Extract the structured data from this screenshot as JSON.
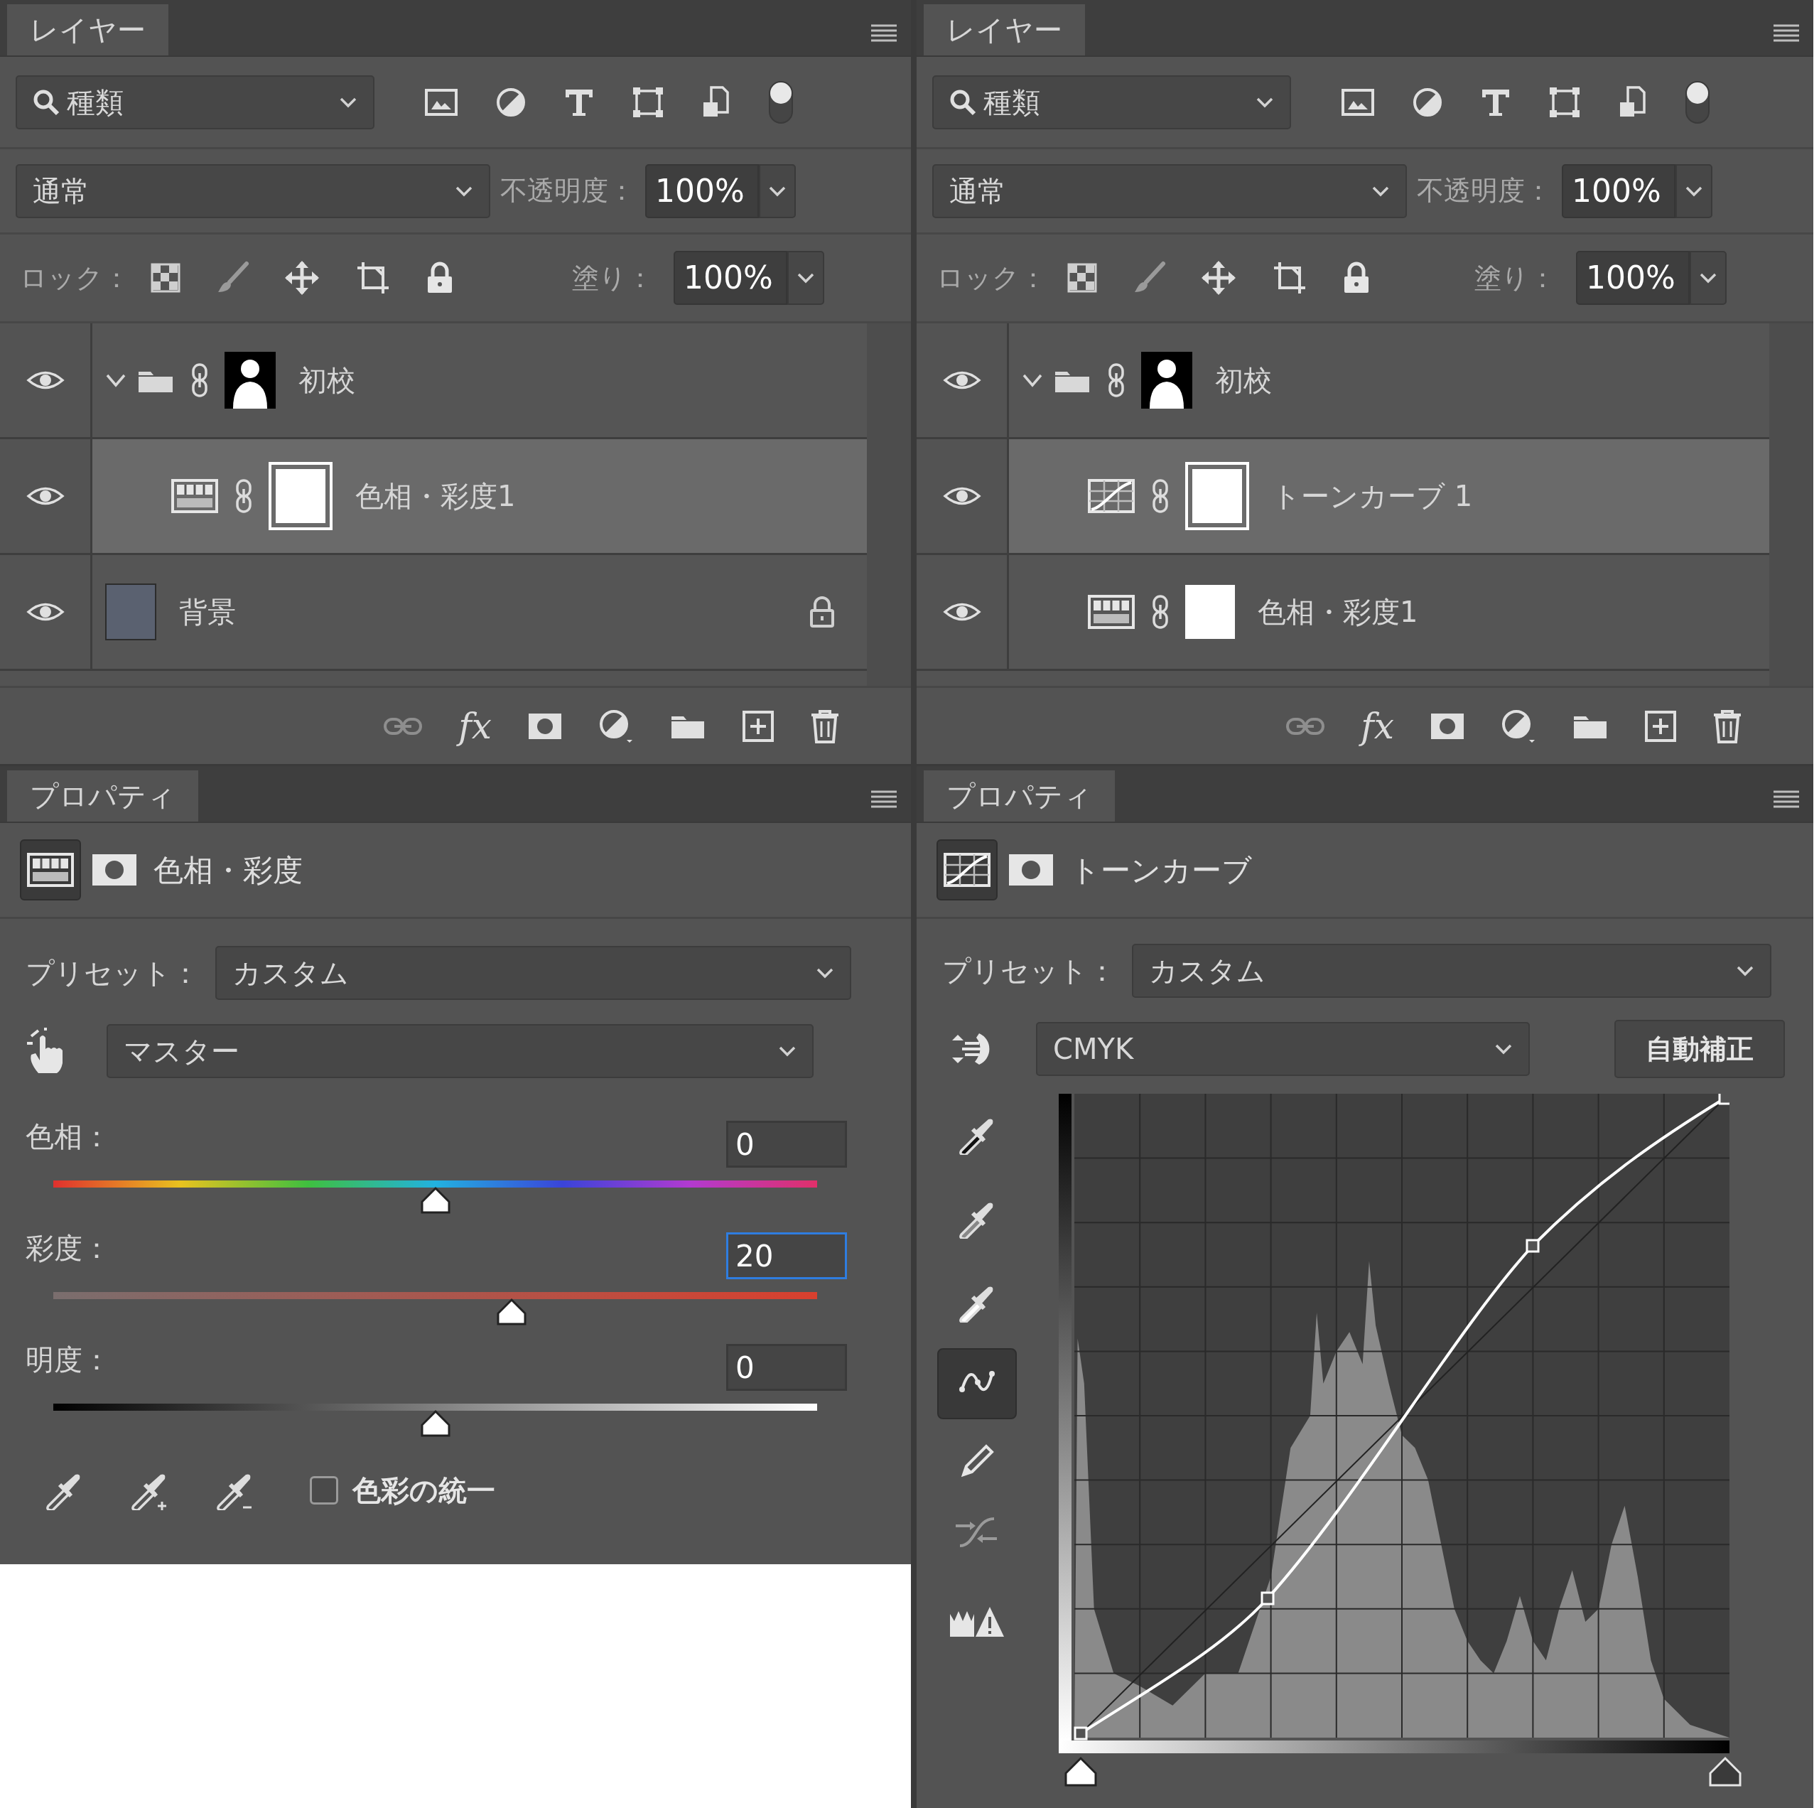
{
  "columns": [
    {
      "layers_panel": {
        "tab": "レイヤー",
        "filter": "種類",
        "blend_mode": "通常",
        "opacity_label": "不透明度：",
        "opacity": "100%",
        "lock_label": "ロック：",
        "fill_label": "塗り：",
        "fill": "100%",
        "effects_label": "fx",
        "layers": [
          {
            "kind": "group",
            "name": "初校",
            "visible": true,
            "selected": false,
            "expanded": true,
            "children": [
              {
                "kind": "hue_saturation",
                "name": "色相・彩度1",
                "visible": true,
                "selected": true
              }
            ]
          },
          {
            "kind": "image",
            "name": "背景",
            "visible": true,
            "selected": false,
            "locked": true
          }
        ]
      },
      "properties_panel": {
        "tab": "プロパティ",
        "kind": "hue_saturation",
        "title": "色相・彩度",
        "preset_label": "プリセット：",
        "preset": "カスタム",
        "channel": "マスター",
        "sliders": [
          {
            "kind": "hue",
            "label": "色相：",
            "value": "0",
            "level": 0.5,
            "focused": false
          },
          {
            "kind": "saturation",
            "label": "彩度：",
            "value": "20",
            "level": 0.6,
            "focused": true
          },
          {
            "kind": "lightness",
            "label": "明度：",
            "value": "0",
            "level": 0.5,
            "focused": false
          }
        ],
        "colorize": {
          "label": "色彩の統一",
          "checked": false
        }
      }
    },
    {
      "layers_panel": {
        "tab": "レイヤー",
        "filter": "種類",
        "blend_mode": "通常",
        "opacity_label": "不透明度：",
        "opacity": "100%",
        "lock_label": "ロック：",
        "fill_label": "塗り：",
        "fill": "100%",
        "effects_label": "fx",
        "layers": [
          {
            "kind": "group",
            "name": "初校",
            "visible": true,
            "selected": false,
            "expanded": true,
            "children": [
              {
                "kind": "curves",
                "name": "トーンカーブ 1",
                "visible": true,
                "selected": true
              },
              {
                "kind": "hue_saturation",
                "name": "色相・彩度1",
                "visible": true,
                "selected": false
              }
            ]
          }
        ]
      },
      "properties_panel": {
        "tab": "プロパティ",
        "kind": "curves",
        "title": "トーンカーブ",
        "preset_label": "プリセット：",
        "preset": "カスタム",
        "channel": "CMYK",
        "auto_button": "自動補正",
        "tools": [
          {
            "kind": "curve",
            "selected": true
          },
          {
            "kind": "pencil",
            "selected": false
          }
        ],
        "input_sliders": [
          {
            "level": 0
          },
          {
            "level": 1
          }
        ]
      }
    }
  ]
}
